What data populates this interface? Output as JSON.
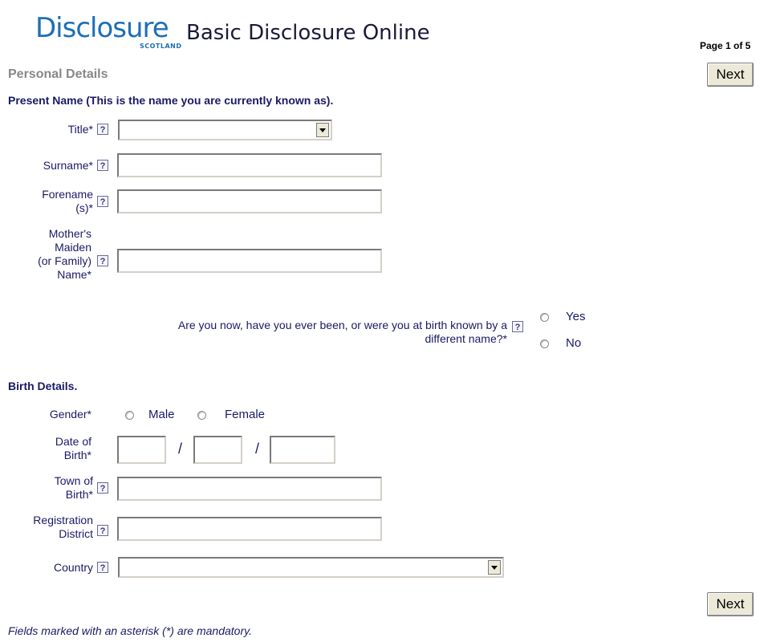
{
  "header": {
    "logo_main": "Disclosure",
    "logo_sub": "SCOTLAND",
    "app_title": "Basic Disclosure Online",
    "page_indicator": "Page 1 of 5"
  },
  "section_title": "Personal Details",
  "next_label": "Next",
  "help_glyph": "?",
  "present_name": {
    "heading": "Present Name (This is the name you are currently known as).",
    "title_label": "Title*",
    "title_value": "",
    "surname_label": "Surname*",
    "surname_value": "",
    "forename_label_1": "Forename",
    "forename_label_2": "(s)*",
    "forename_value": "",
    "maiden_label_1": "Mother's",
    "maiden_label_2": "Maiden",
    "maiden_label_3": "(or Family)",
    "maiden_label_4": "Name*",
    "maiden_value": "",
    "other_name_q1": "Are you now, have you ever been, or were you at birth known by a",
    "other_name_q2": "different name?*",
    "yes_label": "Yes",
    "no_label": "No"
  },
  "birth": {
    "heading": "Birth Details.",
    "gender_label": "Gender*",
    "male_label": "Male",
    "female_label": "Female",
    "dob_label_1": "Date of",
    "dob_label_2": "Birth*",
    "dob_sep": "/",
    "town_label_1": "Town of",
    "town_label_2": "Birth*",
    "regdist_label_1": "Registration",
    "regdist_label_2": "District",
    "country_label": "Country",
    "country_value": ""
  },
  "footer_note": "Fields marked with an asterisk (*) are mandatory."
}
